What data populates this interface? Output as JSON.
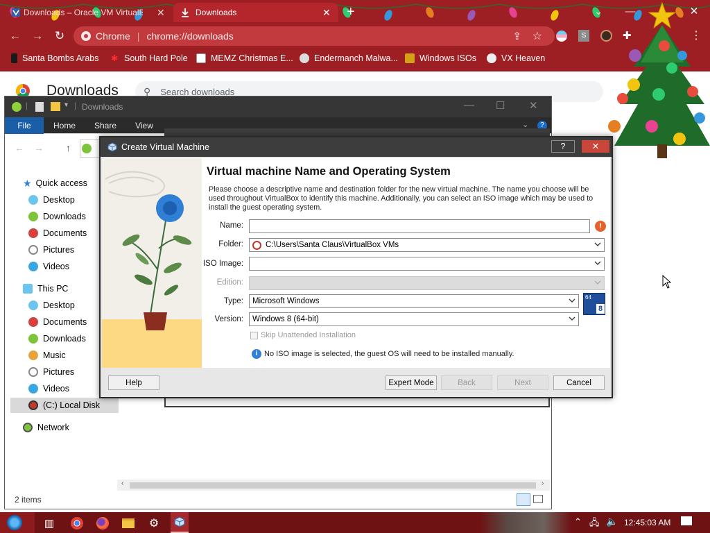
{
  "browser": {
    "tabs": [
      {
        "label": "Downloads – Oracle VM VirtualB..."
      },
      {
        "label": "Downloads"
      }
    ],
    "omnibox": {
      "site": "Chrome",
      "url": "chrome://downloads"
    },
    "bookmarks": [
      {
        "label": "Santa Bombs Arabs"
      },
      {
        "label": "South Hard Pole"
      },
      {
        "label": "MEMZ Christmas E..."
      },
      {
        "label": "Endermanch Malwa..."
      },
      {
        "label": "Windows ISOs"
      },
      {
        "label": "VX Heaven"
      }
    ],
    "profile_letter": "S"
  },
  "downloads_page": {
    "title": "Downloads",
    "search_placeholder": "Search downloads"
  },
  "explorer": {
    "title": "Downloads",
    "ribbon_tabs": [
      "File",
      "Home",
      "Share",
      "View"
    ],
    "nav": {
      "quick_access": "Quick access",
      "quick_items": [
        "Desktop",
        "Downloads",
        "Documents",
        "Pictures",
        "Videos"
      ],
      "this_pc": "This PC",
      "pc_items": [
        "Desktop",
        "Documents",
        "Downloads",
        "Music",
        "Pictures",
        "Videos",
        "(C:) Local Disk"
      ],
      "network": "Network"
    },
    "status": "2 items"
  },
  "dialog": {
    "window_title": "Create Virtual Machine",
    "help_glyph": "?",
    "heading": "Virtual machine Name and Operating System",
    "description": "Please choose a descriptive name and destination folder for the new virtual machine. The name you choose will be used throughout VirtualBox to identify this machine. Additionally, you can select an ISO image which may be used to install the guest operating system.",
    "fields": {
      "name_label": "Name:",
      "name_value": "",
      "folder_label": "Folder:",
      "folder_value": "C:\\Users\\Santa Claus\\VirtualBox VMs",
      "iso_label": "ISO Image:",
      "iso_value": "",
      "edition_label": "Edition:",
      "type_label": "Type:",
      "type_value": "Microsoft Windows",
      "version_label": "Version:",
      "version_value": "Windows 8 (64-bit)"
    },
    "os_badge": {
      "top": "64",
      "bottom": "8"
    },
    "skip_unattended": "Skip Unattended Installation",
    "info_text": "No ISO image is selected, the guest OS will need to be installed manually.",
    "buttons": {
      "help": "Help",
      "expert": "Expert Mode",
      "back": "Back",
      "next": "Next",
      "cancel": "Cancel"
    }
  },
  "taskbar": {
    "clock": "12:45:03 AM"
  },
  "colors": {
    "chrome_red": "#9e1f23",
    "taskbar": "#6e1214",
    "heading": "#111111",
    "explorer_file_tab": "#1a5ea8"
  }
}
